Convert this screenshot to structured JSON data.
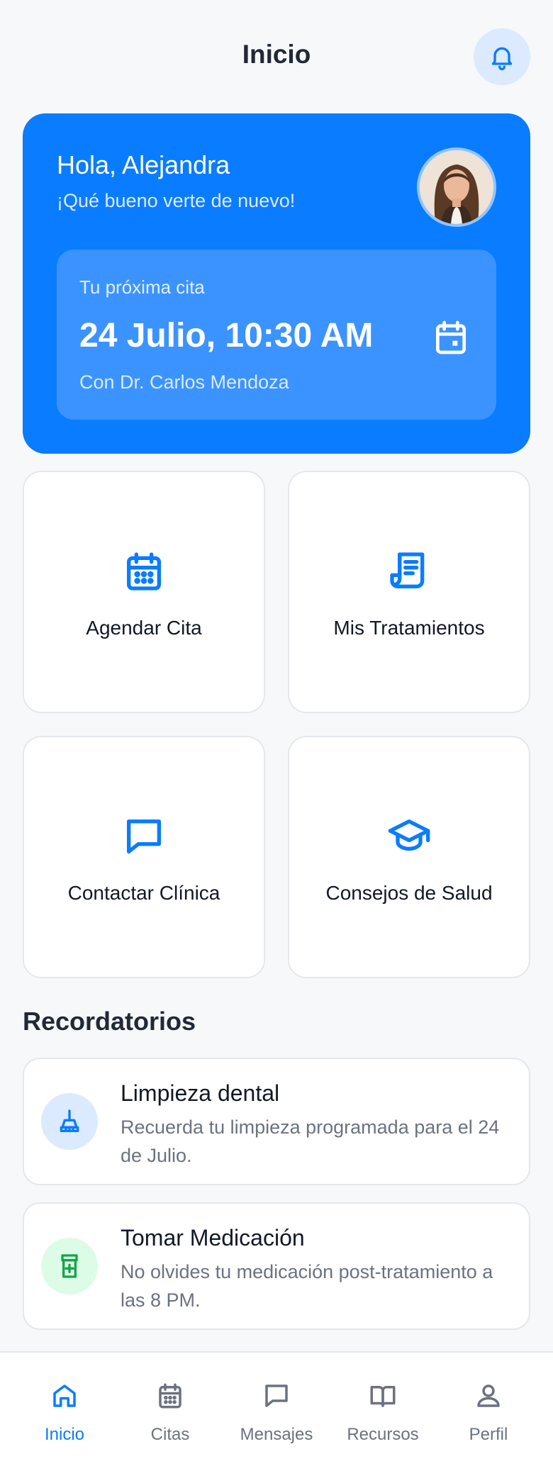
{
  "header": {
    "title": "Inicio"
  },
  "hero": {
    "greeting": "Hola, Alejandra",
    "subtitle": "¡Qué bueno verte de nuevo!",
    "next_appointment": {
      "label": "Tu próxima cita",
      "datetime": "24 Julio, 10:30 AM",
      "doctor": "Con Dr. Carlos Mendoza"
    }
  },
  "actions": [
    {
      "label": "Agendar Cita",
      "icon": "calendar-grid-icon"
    },
    {
      "label": "Mis Tratamientos",
      "icon": "receipt-icon"
    },
    {
      "label": "Contactar Clínica",
      "icon": "chat-icon"
    },
    {
      "label": "Consejos de Salud",
      "icon": "graduation-cap-icon"
    }
  ],
  "reminders": {
    "title": "Recordatorios",
    "items": [
      {
        "title": "Limpieza dental",
        "description": "Recuerda tu limpieza programada para el 24 de Julio.",
        "icon": "brush-icon"
      },
      {
        "title": "Tomar Medicación",
        "description": "No olvides tu medicación post-tratamiento a las 8 PM.",
        "icon": "medication-icon"
      }
    ]
  },
  "nav": {
    "items": [
      {
        "label": "Inicio",
        "icon": "home-icon",
        "active": true
      },
      {
        "label": "Citas",
        "icon": "calendar-icon"
      },
      {
        "label": "Mensajes",
        "icon": "message-icon"
      },
      {
        "label": "Recursos",
        "icon": "book-icon"
      },
      {
        "label": "Perfil",
        "icon": "person-icon"
      }
    ]
  },
  "colors": {
    "primary": "#0a7cff",
    "background": "#f7f8fa",
    "success": "#16a34a"
  }
}
